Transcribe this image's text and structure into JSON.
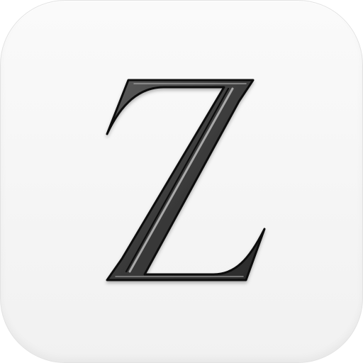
{
  "app_icon": {
    "logo_letter": "Z",
    "background_color": "#f5f5f5",
    "letter_fill_color": "#3a3a3a",
    "letter_outline_color": "#0f0f0f",
    "letter_highlight_color": "#9a9a9a",
    "icon": "z-logo-icon"
  }
}
